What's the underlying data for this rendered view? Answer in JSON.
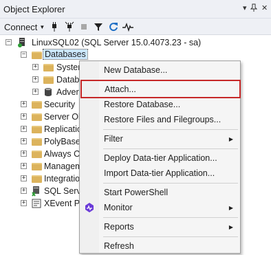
{
  "panel": {
    "title": "Object Explorer",
    "controls": {
      "dropdown": "▾",
      "pin": "📌",
      "close": "✕"
    }
  },
  "toolbar": {
    "connect_label": "Connect",
    "icons": [
      "connect-icon",
      "disconnect-icon",
      "stop-icon",
      "filter-icon",
      "refresh-icon",
      "activity-monitor-icon"
    ]
  },
  "tree": {
    "server": "LinuxSQL02 (SQL Server 15.0.4073.23 - sa)",
    "databases": "Databases",
    "db_children": [
      "Syster",
      "Datab",
      "Adver"
    ],
    "server_children": [
      "Security",
      "Server Obj",
      "Replicatio",
      "PolyBase",
      "Always Or",
      "Managem",
      "Integratio",
      "SQL Serve",
      "XEvent Pr"
    ]
  },
  "context_menu": {
    "items": [
      "New Database...",
      "Attach...",
      "Restore Database...",
      "Restore Files and Filegroups...",
      "Filter",
      "Deploy Data-tier Application...",
      "Import Data-tier Application...",
      "Start PowerShell",
      "Monitor",
      "Reports",
      "Refresh"
    ]
  },
  "colors": {
    "highlight_border": "#c62828",
    "selection": "#cce8ff",
    "folder": "#dcb35c"
  }
}
